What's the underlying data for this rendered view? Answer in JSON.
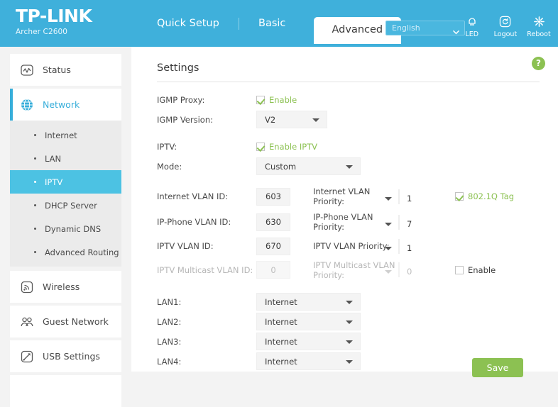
{
  "header": {
    "logo": "TP-LINK",
    "model": "Archer C2600",
    "nav": [
      {
        "label": "Quick Setup",
        "active": false
      },
      {
        "label": "Basic",
        "active": false
      }
    ],
    "active_tab": "Advanced",
    "language": "English",
    "icons": [
      {
        "name": "led-icon",
        "label": "LED"
      },
      {
        "name": "logout-icon",
        "label": "Logout"
      },
      {
        "name": "reboot-icon",
        "label": "Reboot"
      }
    ]
  },
  "sidebar": {
    "status": {
      "label": "Status",
      "icon": "status-icon"
    },
    "network": {
      "label": "Network",
      "icon": "globe-icon",
      "active": true
    },
    "network_children": [
      {
        "label": "Internet",
        "active": false
      },
      {
        "label": "LAN",
        "active": false
      },
      {
        "label": "IPTV",
        "active": true
      },
      {
        "label": "DHCP Server",
        "active": false
      },
      {
        "label": "Dynamic DNS",
        "active": false
      },
      {
        "label": "Advanced Routing",
        "active": false
      }
    ],
    "wireless": {
      "label": "Wireless",
      "icon": "wireless-icon"
    },
    "guest": {
      "label": "Guest Network",
      "icon": "guest-network-icon"
    },
    "usb": {
      "label": "USB Settings",
      "icon": "usb-icon"
    }
  },
  "main": {
    "title": "Settings",
    "help": "?",
    "igmp_proxy": {
      "label": "IGMP Proxy:",
      "checkbox_label": "Enable",
      "checked": true
    },
    "igmp_version": {
      "label": "IGMP Version:",
      "value": "V2"
    },
    "iptv": {
      "label": "IPTV:",
      "checkbox_label": "Enable IPTV",
      "checked": true
    },
    "mode": {
      "label": "Mode:",
      "value": "Custom"
    },
    "vlan_rows": [
      {
        "id_label": "Internet VLAN ID:",
        "id_value": "603",
        "pri_label": "Internet VLAN Priority:",
        "pri_value": "1",
        "disabled": false,
        "extra": {
          "type": "checkbox",
          "label": "802.1Q Tag",
          "checked": true,
          "green": true
        }
      },
      {
        "id_label": "IP-Phone VLAN ID:",
        "id_value": "630",
        "pri_label": "IP-Phone VLAN Priority:",
        "pri_value": "7",
        "disabled": false,
        "extra": null
      },
      {
        "id_label": "IPTV VLAN ID:",
        "id_value": "670",
        "pri_label": "IPTV VLAN Priority:",
        "pri_value": "1",
        "disabled": false,
        "extra": null
      },
      {
        "id_label": "IPTV Multicast VLAN ID:",
        "id_value": "0",
        "pri_label": "IPTV Multicast VLAN Priority:",
        "pri_value": "0",
        "disabled": true,
        "extra": {
          "type": "checkbox",
          "label": "Enable",
          "checked": false,
          "green": false
        }
      }
    ],
    "lan_rows": [
      {
        "label": "LAN1:",
        "value": "Internet"
      },
      {
        "label": "LAN2:",
        "value": "Internet"
      },
      {
        "label": "LAN3:",
        "value": "Internet"
      },
      {
        "label": "LAN4:",
        "value": "Internet"
      }
    ],
    "save_label": "Save"
  },
  "colors": {
    "brand_blue": "#3fb0db",
    "accent_cyan": "#4cc2e3",
    "green": "#8cc152"
  }
}
